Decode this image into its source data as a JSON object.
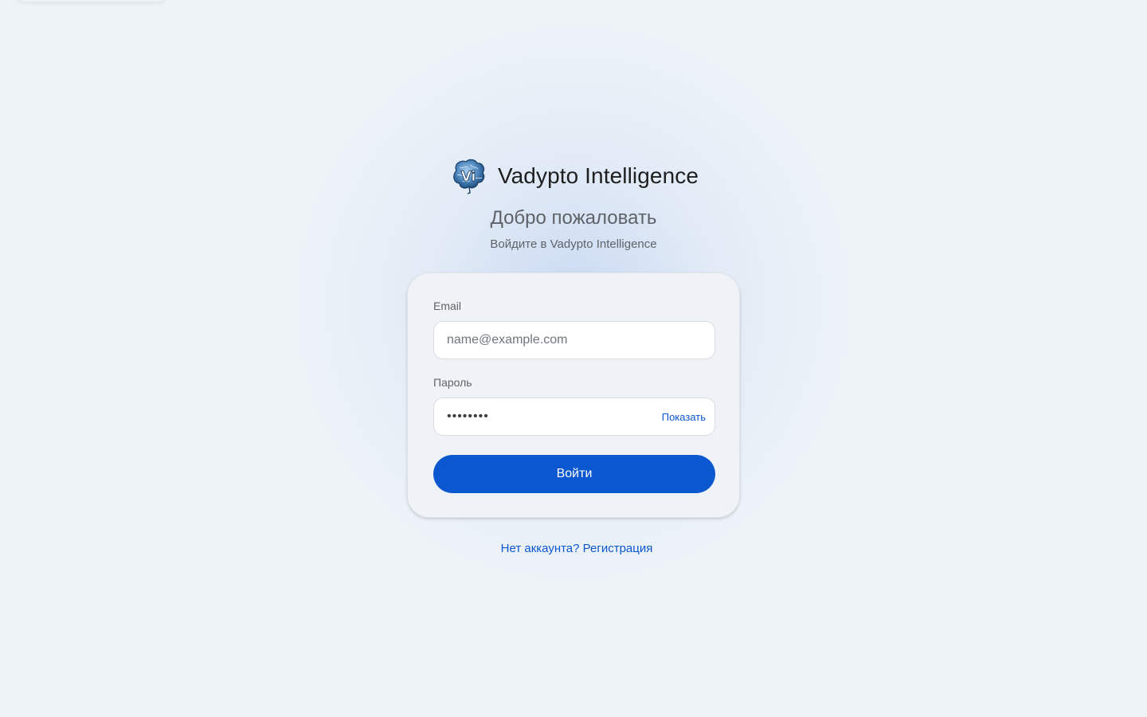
{
  "brand": {
    "name": "Vadypto Intelligence",
    "logo_icon": "brain-logo-icon",
    "logo_letters": "Vi"
  },
  "header": {
    "title": "Добро пожаловать",
    "subtitle": "Войдите в Vadypto Intelligence"
  },
  "form": {
    "email_label": "Email",
    "email_placeholder": "name@example.com",
    "email_value": "",
    "password_label": "Пароль",
    "password_value": "••••••••",
    "show_password_label": "Показать",
    "submit_label": "Войти"
  },
  "footer": {
    "register_link": "Нет аккаунта? Регистрация"
  },
  "colors": {
    "accent": "#0b57d0",
    "background": "#eef3f8",
    "card": "#eff3f8"
  }
}
